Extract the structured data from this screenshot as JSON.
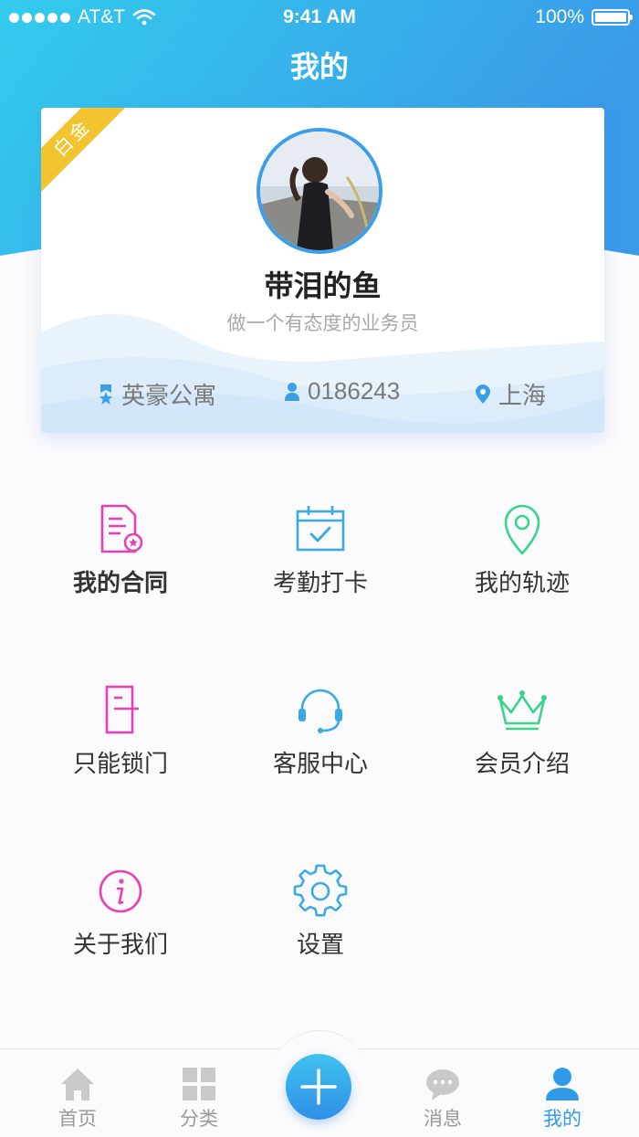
{
  "status_bar": {
    "carrier": "AT&T",
    "time": "9:41 AM",
    "battery": "100%",
    "battery_level": 1.0
  },
  "nav": {
    "title": "我的"
  },
  "profile": {
    "badge": "白金",
    "name": "带泪的鱼",
    "tagline": "做一个有态度的业务员",
    "company": "英豪公寓",
    "employee_id": "0186243",
    "city": "上海"
  },
  "menu": [
    {
      "label": "我的合同",
      "icon": "contract-icon",
      "color": "#e83fb7"
    },
    {
      "label": "考勤打卡",
      "icon": "calendar-check-icon",
      "color": "#3aa9e8"
    },
    {
      "label": "我的轨迹",
      "icon": "location-pin-icon",
      "color": "#37d48a"
    },
    {
      "label": "只能锁门",
      "icon": "door-icon",
      "color": "#e83fb7"
    },
    {
      "label": "客服中心",
      "icon": "headset-icon",
      "color": "#3aa9e8"
    },
    {
      "label": "会员介绍",
      "icon": "crown-icon",
      "color": "#37d48a"
    },
    {
      "label": "关于我们",
      "icon": "info-icon",
      "color": "#e83fb7"
    },
    {
      "label": "设置",
      "icon": "gear-icon",
      "color": "#3aa9e8"
    }
  ],
  "tabbar": {
    "items": [
      {
        "label": "首页",
        "icon": "home-icon"
      },
      {
        "label": "分类",
        "icon": "category-icon"
      },
      {
        "label": "消息",
        "icon": "message-icon"
      },
      {
        "label": "我的",
        "icon": "user-icon"
      }
    ],
    "active_color": "#2f9be8",
    "inactive_color": "#9a9a9a"
  },
  "colors": {
    "header_start": "#33cbed",
    "header_end": "#3a9ae8",
    "ribbon": "#f2c530"
  }
}
